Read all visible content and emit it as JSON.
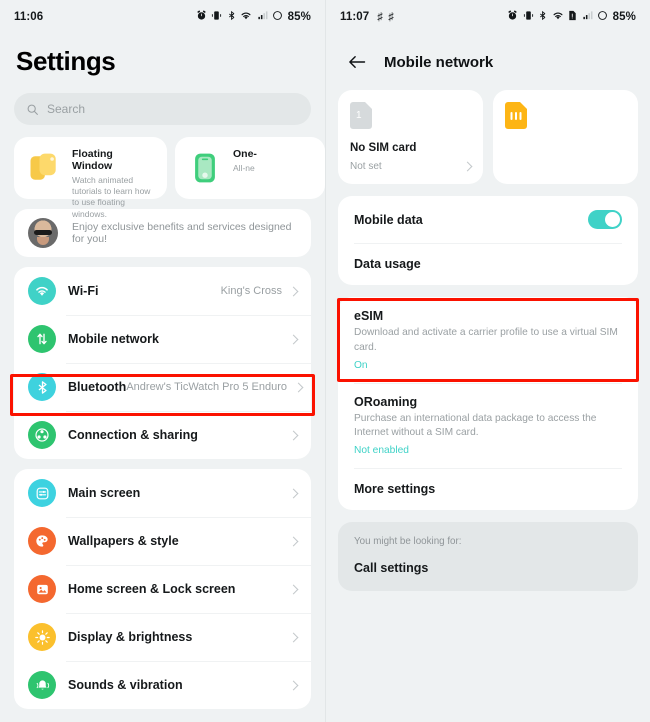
{
  "left_panel": {
    "status_bar": {
      "time": "11:06",
      "left_icons": [],
      "right_icons": [
        "alarm-icon",
        "vibrate-icon",
        "bluetooth-icon",
        "wifi-icon",
        "signal-icon"
      ],
      "battery": "85%"
    },
    "page_title": "Settings",
    "search": {
      "placeholder": "Search"
    },
    "promo_cards": [
      {
        "title": "Floating Window",
        "desc": "Watch animated tutorials to learn how to use floating windows.",
        "icon": "floating-window-icon"
      },
      {
        "title": "One-",
        "desc": "All-ne",
        "icon": "one-handed-icon"
      }
    ],
    "account": {
      "text": "Enjoy exclusive benefits and services designed for you!"
    },
    "group_one": [
      {
        "label": "Wi-Fi",
        "value": "King's Cross",
        "icon": "wifi-icon",
        "color": "#3fd2c7"
      },
      {
        "label": "Mobile network",
        "value": "",
        "icon": "mobile-network-icon",
        "color": "#2ec46f"
      },
      {
        "label": "Bluetooth",
        "value": "Andrew's TicWatch Pro 5 Enduro",
        "icon": "bluetooth-icon",
        "color": "#3ed2de"
      },
      {
        "label": "Connection & sharing",
        "value": "",
        "icon": "connection-sharing-icon",
        "color": "#2ec46f"
      }
    ],
    "group_two": [
      {
        "label": "Main screen",
        "value": "",
        "icon": "main-screen-icon",
        "color": "#3dd2e0"
      },
      {
        "label": "Wallpapers & style",
        "value": "",
        "icon": "wallpapers-style-icon",
        "color": "#f4682f"
      },
      {
        "label": "Home screen & Lock screen",
        "value": "",
        "icon": "home-lock-screen-icon",
        "color": "#f4682f"
      },
      {
        "label": "Display & brightness",
        "value": "",
        "icon": "display-brightness-icon",
        "color": "#fbc02d"
      },
      {
        "label": "Sounds & vibration",
        "value": "",
        "icon": "sounds-vibration-icon",
        "color": "#2ec46f"
      }
    ]
  },
  "right_panel": {
    "status_bar": {
      "time": "11:07",
      "left_icons": [
        "gmail-icon",
        "gmail-icon"
      ],
      "right_icons": [
        "alarm-icon",
        "vibrate-icon",
        "bluetooth-icon",
        "wifi-icon",
        "sim-alert-icon",
        "signal-icon"
      ],
      "battery": "85%"
    },
    "app_bar": {
      "title": "Mobile network",
      "back": "back-arrow-icon"
    },
    "sim_cards": [
      {
        "slot": "1",
        "name": "No SIM card",
        "status": "Not set",
        "icon": "sim-card-gray-icon"
      },
      {
        "slot": "",
        "name": "",
        "status": "",
        "icon": "sim-card-orange-icon"
      }
    ],
    "data_group": {
      "mobile_data_label": "Mobile data",
      "mobile_data_on": true,
      "data_usage_label": "Data usage"
    },
    "esim_group": [
      {
        "label": "eSIM",
        "desc": "Download and activate a carrier profile to use a virtual SIM card.",
        "state": "On"
      },
      {
        "label": "ORoaming",
        "desc": "Purchase an international data package to access the Internet without a SIM card.",
        "state": "Not enabled"
      }
    ],
    "more_settings_label": "More settings",
    "hint": {
      "title": "You might be looking for:",
      "item": "Call settings"
    }
  },
  "colors": {
    "highlight": "#fb1200",
    "accent_teal": "#3fd2c7",
    "background": "#eff2f3"
  }
}
